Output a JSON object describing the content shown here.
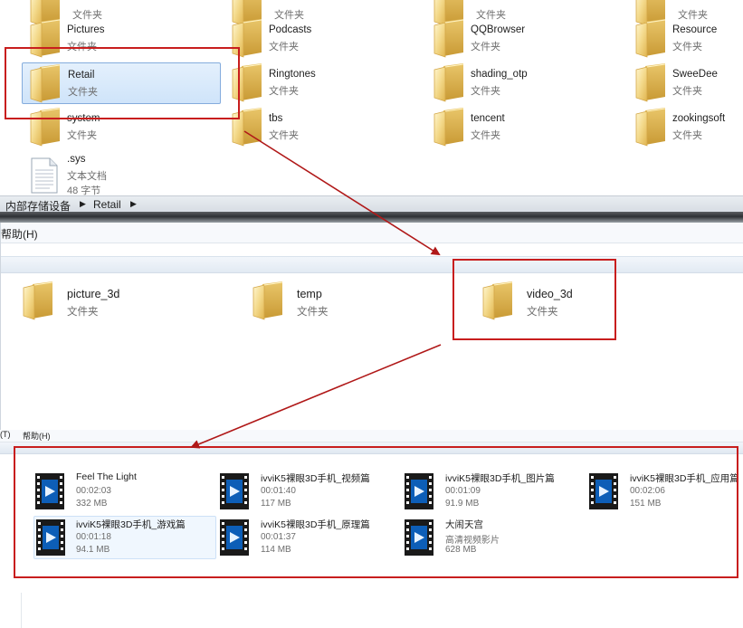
{
  "panel1": {
    "row0": [
      {
        "name": "",
        "type": "文件夹"
      },
      {
        "name": "",
        "type": "文件夹"
      },
      {
        "name": "",
        "type": "文件夹"
      },
      {
        "name": "",
        "type": "文件夹"
      }
    ],
    "row1": [
      {
        "name": "Pictures",
        "type": "文件夹"
      },
      {
        "name": "Podcasts",
        "type": "文件夹"
      },
      {
        "name": "QQBrowser",
        "type": "文件夹"
      },
      {
        "name": "Resource",
        "type": "文件夹"
      }
    ],
    "row2": [
      {
        "name": "Retail",
        "type": "文件夹"
      },
      {
        "name": "Ringtones",
        "type": "文件夹"
      },
      {
        "name": "shading_otp",
        "type": "文件夹"
      },
      {
        "name": "SweeDee",
        "type": "文件夹"
      }
    ],
    "row3": [
      {
        "name": "system",
        "type": "文件夹"
      },
      {
        "name": "tbs",
        "type": "文件夹"
      },
      {
        "name": "tencent",
        "type": "文件夹"
      },
      {
        "name": "zookingsoft",
        "type": "文件夹"
      }
    ],
    "sysfile": {
      "name": ".sys",
      "type": "文本文档",
      "size": "48 字节"
    },
    "breadcrumb": [
      "内部存储设备",
      "Retail"
    ]
  },
  "panel2": {
    "menu_help": "帮助(H)",
    "folders": [
      {
        "name": "picture_3d",
        "type": "文件夹"
      },
      {
        "name": "temp",
        "type": "文件夹"
      },
      {
        "name": "video_3d",
        "type": "文件夹"
      }
    ]
  },
  "panel3": {
    "menu_tools": "(T)",
    "menu_help": "帮助(H)",
    "videos": [
      {
        "name": "Feel The Light",
        "duration": "00:02:03",
        "size": "332 MB"
      },
      {
        "name": "ivviK5裸眼3D手机_视频篇",
        "duration": "00:01:40",
        "size": "117 MB"
      },
      {
        "name": "ivviK5裸眼3D手机_图片篇",
        "duration": "00:01:09",
        "size": "91.9 MB"
      },
      {
        "name": "ivviK5裸眼3D手机_应用篇",
        "duration": "00:02:06",
        "size": "151 MB"
      },
      {
        "name": "ivviK5裸眼3D手机_游戏篇",
        "duration": "00:01:18",
        "size": "94.1 MB"
      },
      {
        "name": "ivviK5裸眼3D手机_原理篇",
        "duration": "00:01:37",
        "size": "114 MB"
      },
      {
        "name": "大闹天宫",
        "duration": "高清视频影片",
        "size": "628 MB"
      }
    ]
  },
  "colors": {
    "highlight": "#c81e1e",
    "selection": "#cde4fa",
    "arrow": "#b01818"
  }
}
